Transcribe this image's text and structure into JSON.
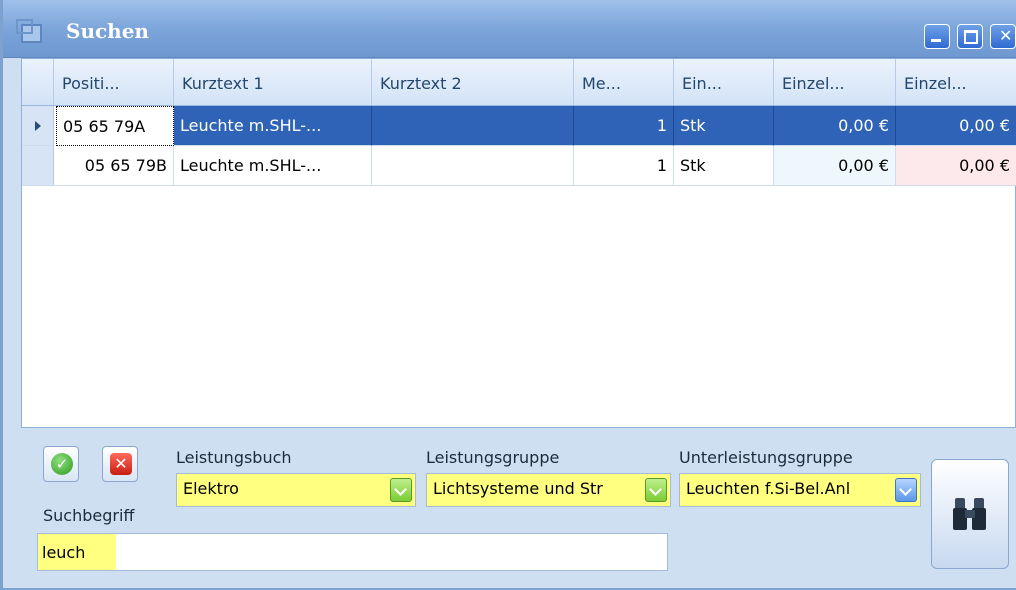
{
  "window": {
    "title": "Suchen",
    "icon": "window-icon"
  },
  "grid": {
    "columns": [
      "Positi...",
      "Kurztext 1",
      "Kurztext 2",
      "Me...",
      "Ein...",
      "Einzel...",
      "Einzel..."
    ],
    "rows": [
      {
        "pos": "05 65 79A",
        "kurztext1": "Leuchte m.SHL-...",
        "kurztext2": "",
        "menge": "1",
        "einheit": "Stk",
        "einzel1": "0,00 €",
        "einzel2": "0,00 €",
        "selected": true
      },
      {
        "pos": "05 65 79B",
        "kurztext1": "Leuchte m.SHL-...",
        "kurztext2": "",
        "menge": "1",
        "einheit": "Stk",
        "einzel1": "0,00 €",
        "einzel2": "0,00 €",
        "selected": false
      }
    ]
  },
  "filters": {
    "leistungsbuch": {
      "label": "Leistungsbuch",
      "value": "Elektro"
    },
    "leistungsgruppe": {
      "label": "Leistungsgruppe",
      "value": "Lichtsysteme und Str"
    },
    "unterleistungsgruppe": {
      "label": "Unterleistungsgruppe",
      "value": "Leuchten f.Si-Bel.Anl"
    }
  },
  "search": {
    "label": "Suchbegriff",
    "value": "leuch"
  },
  "colors": {
    "selection": "#2f63b7",
    "highlight": "#ffff80",
    "accent": "#7aa3d9"
  }
}
